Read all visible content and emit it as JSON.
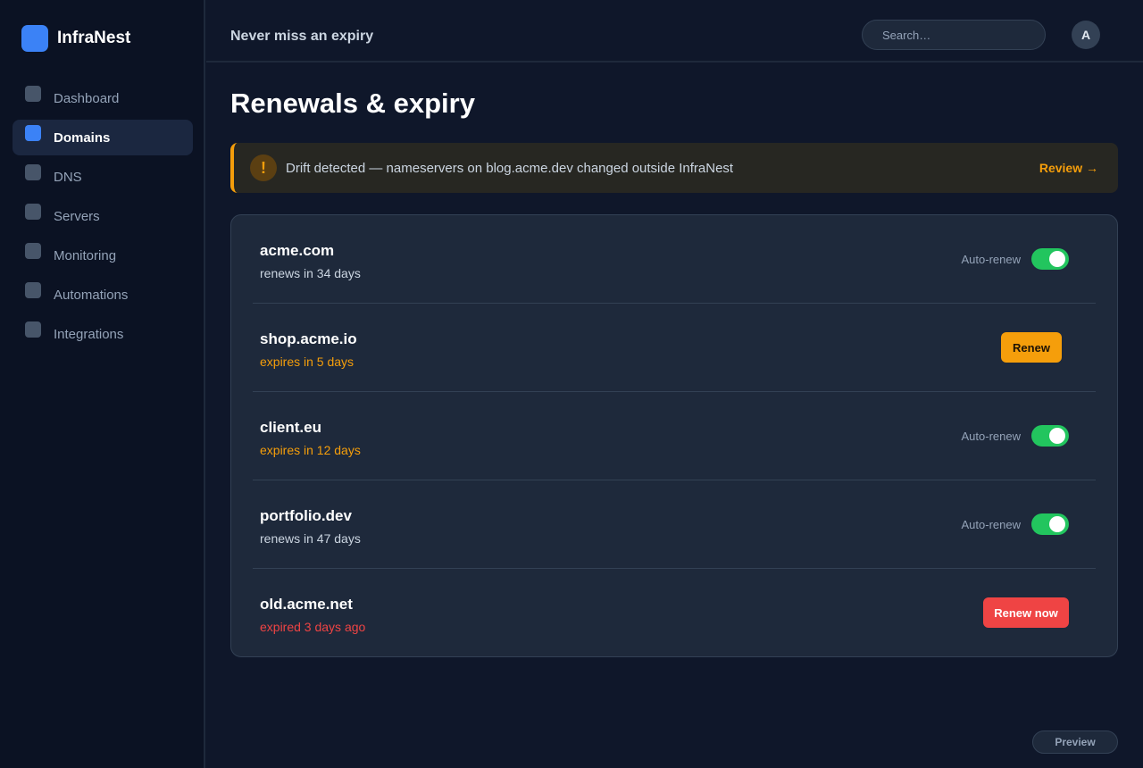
{
  "brand": {
    "name": "InfraNest"
  },
  "sidebar": {
    "items": [
      {
        "label": "Dashboard"
      },
      {
        "label": "Domains"
      },
      {
        "label": "DNS"
      },
      {
        "label": "Servers"
      },
      {
        "label": "Monitoring"
      },
      {
        "label": "Automations"
      },
      {
        "label": "Integrations"
      }
    ],
    "active": "Domains"
  },
  "header": {
    "tagline": "Never miss an expiry",
    "search_placeholder": "Search…",
    "avatar_initial": "A"
  },
  "page": {
    "title": "Renewals & expiry"
  },
  "alert": {
    "icon": "!",
    "message": "Drift detected — nameservers on blog.acme.dev changed outside InfraNest",
    "link_label": "Review →"
  },
  "domains": [
    {
      "name": "acme.com",
      "status": "renews in 34 days",
      "status_tone": "normal",
      "auto_renew_label": "Auto-renew",
      "auto_renew": true
    },
    {
      "name": "shop.acme.io",
      "status": "expires in 5 days",
      "status_tone": "warn",
      "action_label": "Renew"
    },
    {
      "name": "client.eu",
      "status": "expires in 12 days",
      "status_tone": "warn",
      "auto_renew_label": "Auto-renew",
      "auto_renew": true
    },
    {
      "name": "portfolio.dev",
      "status": "renews in 47 days",
      "status_tone": "normal",
      "auto_renew_label": "Auto-renew",
      "auto_renew": true
    },
    {
      "name": "old.acme.net",
      "status": "expired 3 days ago",
      "status_tone": "danger",
      "action_label": "Renew now"
    }
  ],
  "footer": {
    "preview_label": "Preview"
  },
  "colors": {
    "accent": "#3b82f6",
    "warning": "#f59e0b",
    "danger": "#ef4444",
    "success": "#22c55e"
  }
}
